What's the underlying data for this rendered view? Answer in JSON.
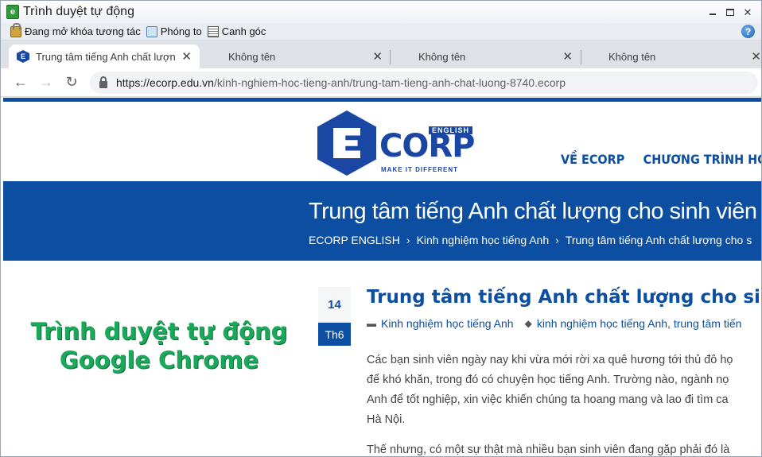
{
  "window": {
    "title": "Trình duyệt tự động"
  },
  "toolbar": {
    "items": [
      {
        "label": "Đang mở khóa tương tác",
        "icon": "lock-icon"
      },
      {
        "label": "Phóng to",
        "icon": "zoom-icon"
      },
      {
        "label": "Canh góc",
        "icon": "corner-align-icon"
      }
    ]
  },
  "tabs": [
    {
      "label": "Trung tâm tiếng Anh chất lượng c",
      "active": true
    },
    {
      "label": "Không tên",
      "active": false
    },
    {
      "label": "Không tên",
      "active": false
    },
    {
      "label": "Không tên",
      "active": false
    }
  ],
  "address": {
    "host": "https://ecorp.edu.vn",
    "path": "/kinh-nghiem-hoc-tieng-anh/trung-tam-tieng-anh-chat-luong-8740.ecorp"
  },
  "site": {
    "logo": {
      "word": "CORP",
      "badge": "ENGLISH",
      "tagline": "MAKE IT DIFFERENT"
    },
    "menu": [
      "VỀ ECORP",
      "CHƯƠNG TRÌNH HỌC"
    ],
    "banner_title": "Trung tâm tiếng Anh chất lượng cho sinh viên",
    "breadcrumb": [
      "ECORP ENGLISH",
      "Kinh nghiệm học tiếng Anh",
      "Trung tâm tiếng Anh chất lượng cho s"
    ]
  },
  "overlay": {
    "line1": "Trình duyệt tự động",
    "line2": "Google Chrome"
  },
  "post": {
    "date_day": "14",
    "date_month": "Th6",
    "title": "Trung tâm tiếng Anh chất lượng cho sinh vi",
    "category": "Kinh nghiệm học tiếng Anh",
    "tags": "kinh nghiệm học tiếng Anh, trung tâm tiến",
    "body_lines": [
      "Các bạn sinh viên ngày nay khi vừa mới rời xa quê hương tới thủ đô họ",
      "để khó khăn, trong đó có chuyện học tiếng Anh. Trường nào, ngành nọ",
      "Anh để tốt nghiệp, xin việc khiến chúng ta hoang mang và lao đi tìm ca",
      "Hà Nội."
    ],
    "para2": "Thế nhưng, có một sự thật mà nhiều bạn sinh viên đang gặp phải đó là"
  }
}
